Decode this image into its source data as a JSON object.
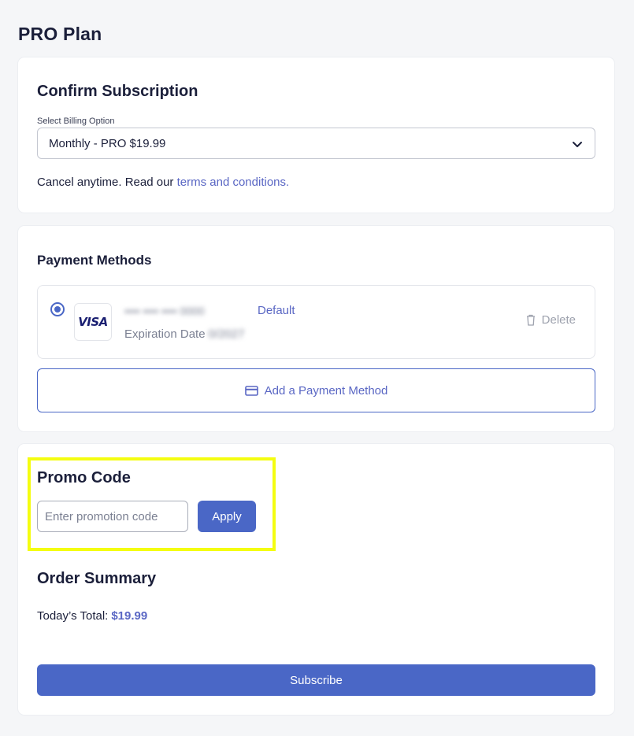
{
  "page": {
    "title": "PRO Plan"
  },
  "confirm": {
    "heading": "Confirm Subscription",
    "billing_label": "Select Billing Option",
    "billing_value": "Monthly - PRO $19.99",
    "cancel_text": "Cancel anytime. Read our ",
    "terms_link": "terms and conditions."
  },
  "payment": {
    "heading": "Payment Methods",
    "method": {
      "brand": "VISA",
      "number": "•••• •••• •••• 0000",
      "default_label": "Default",
      "exp_label": "Expiration Date",
      "exp_value": "0/2027",
      "selected": true
    },
    "delete_label": "Delete",
    "add_label": "Add a Payment Method"
  },
  "promo": {
    "heading": "Promo Code",
    "placeholder": "Enter promotion code",
    "value": "",
    "apply_label": "Apply"
  },
  "order": {
    "heading": "Order Summary",
    "total_label": "Today’s Total:",
    "total_value": "$19.99",
    "subscribe_label": "Subscribe"
  },
  "colors": {
    "accent": "#4a67c6",
    "link": "#5a67c4",
    "highlight": "#f4fd10",
    "background": "#f5f6f8"
  },
  "icons": {
    "select": "chevron-down-icon",
    "delete": "trash-icon",
    "add_payment": "credit-card-icon",
    "radio": "radio-selected-icon"
  }
}
